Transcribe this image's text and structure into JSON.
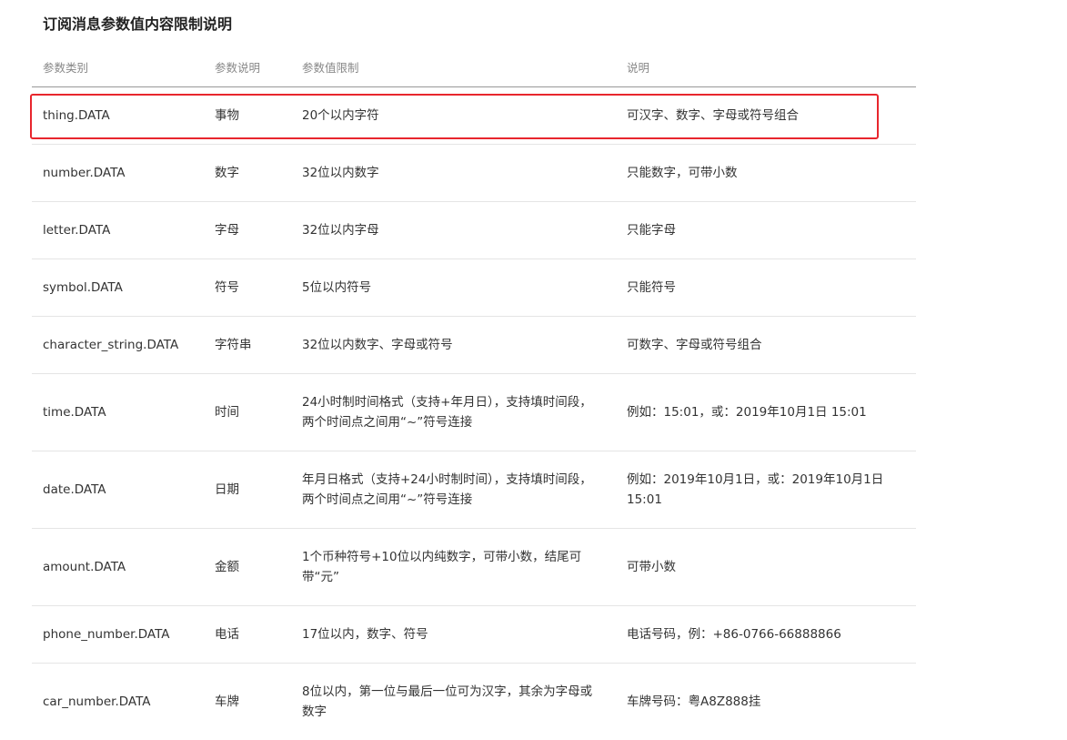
{
  "title": "订阅消息参数值内容限制说明",
  "headers": {
    "type": "参数类别",
    "desc": "参数说明",
    "limit": "参数值限制",
    "note": "说明"
  },
  "rows": [
    {
      "type": "thing.DATA",
      "desc": "事物",
      "limit": "20个以内字符",
      "note": "可汉字、数字、字母或符号组合"
    },
    {
      "type": "number.DATA",
      "desc": "数字",
      "limit": "32位以内数字",
      "note": "只能数字，可带小数"
    },
    {
      "type": "letter.DATA",
      "desc": "字母",
      "limit": "32位以内字母",
      "note": "只能字母"
    },
    {
      "type": "symbol.DATA",
      "desc": "符号",
      "limit": "5位以内符号",
      "note": "只能符号"
    },
    {
      "type": "character_string.DATA",
      "desc": "字符串",
      "limit": "32位以内数字、字母或符号",
      "note": "可数字、字母或符号组合"
    },
    {
      "type": "time.DATA",
      "desc": "时间",
      "limit": "24小时制时间格式（支持+年月日），支持填时间段，两个时间点之间用“~”符号连接",
      "note": "例如：15:01，或：2019年10月1日 15:01"
    },
    {
      "type": "date.DATA",
      "desc": "日期",
      "limit": "年月日格式（支持+24小时制时间），支持填时间段，两个时间点之间用“~”符号连接",
      "note": "例如：2019年10月1日，或：2019年10月1日 15:01"
    },
    {
      "type": "amount.DATA",
      "desc": "金额",
      "limit": "1个币种符号+10位以内纯数字，可带小数，结尾可带“元”",
      "note": "可带小数"
    },
    {
      "type": "phone_number.DATA",
      "desc": "电话",
      "limit": "17位以内，数字、符号",
      "note": "电话号码，例：+86-0766-66888866"
    },
    {
      "type": "car_number.DATA",
      "desc": "车牌",
      "limit": "8位以内，第一位与最后一位可为汉字，其余为字母或数字",
      "note": "车牌号码：粤A8Z888挂"
    }
  ],
  "highlight_color": "#e8262d"
}
